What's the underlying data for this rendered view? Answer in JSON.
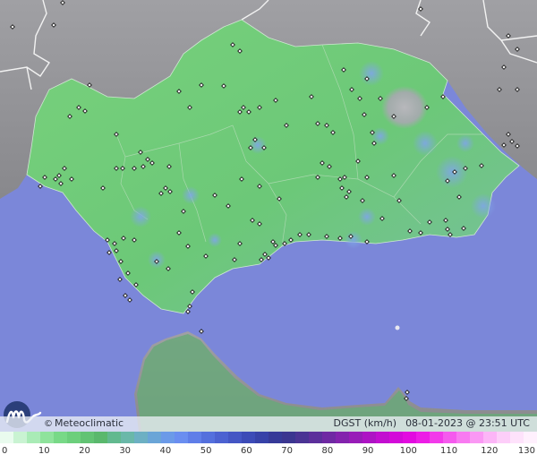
{
  "map": {
    "sea_color": "#7b87d9",
    "land_color": "#8e8e92",
    "region_color": "#6fca74",
    "region_name_visible": false
  },
  "footer": {
    "brand_symbol": "©",
    "brand_name": "Meteoclimatic",
    "variable": "DGST (km/h)",
    "date": "08-01-2023 @ 23:51 UTC"
  },
  "legend": {
    "ticks": [
      "0",
      "10",
      "20",
      "30",
      "40",
      "50",
      "60",
      "70",
      "80",
      "90",
      "100",
      "110",
      "120",
      "130"
    ],
    "colors": [
      "#e9fbee",
      "#c9f3d2",
      "#a9ebb6",
      "#8fe39c",
      "#78d987",
      "#6ccf7c",
      "#62c374",
      "#5ab86d",
      "#62b98f",
      "#6ab8a9",
      "#6db0c3",
      "#6aa5d7",
      "#6b9ae8",
      "#6a8ef0",
      "#5f7ee8",
      "#5470dd",
      "#4c62d1",
      "#4456c4",
      "#3c4bb7",
      "#3742a8",
      "#363a98",
      "#3b3690",
      "#4a3494",
      "#5c2f9b",
      "#6f29a3",
      "#8323ad",
      "#981cb8",
      "#ad14c4",
      "#c20ed0",
      "#d30ad9",
      "#e20be0",
      "#ec1de6",
      "#f23aea",
      "#f55aee",
      "#f87af1",
      "#fa98f4",
      "#fcb5f7",
      "#fdcef9",
      "#fee2fb",
      "#fff0fd"
    ]
  }
}
